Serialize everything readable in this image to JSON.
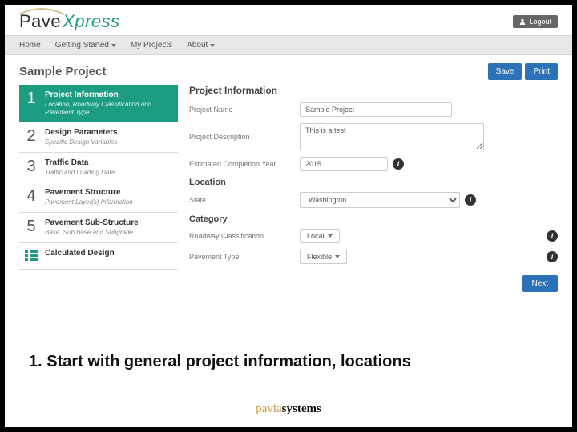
{
  "logo": {
    "part1": "Pave",
    "part2": "Xpress"
  },
  "logout_label": "Logout",
  "nav": {
    "home": "Home",
    "getting_started": "Getting Started",
    "my_projects": "My Projects",
    "about": "About"
  },
  "page_title": "Sample Project",
  "buttons": {
    "save": "Save",
    "print": "Print",
    "next": "Next"
  },
  "steps": [
    {
      "num": "1",
      "title": "Project Information",
      "sub": "Location, Roadway Classification and Pavement Type"
    },
    {
      "num": "2",
      "title": "Design Parameters",
      "sub": "Specific Design Variables"
    },
    {
      "num": "3",
      "title": "Traffic Data",
      "sub": "Traffic and Loading Data"
    },
    {
      "num": "4",
      "title": "Pavement Structure",
      "sub": "Pavement Layer(s) Information"
    },
    {
      "num": "5",
      "title": "Pavement Sub-Structure",
      "sub": "Base, Sub Base and Subgrade"
    }
  ],
  "calc_step": {
    "title": "Calculated Design"
  },
  "form": {
    "heading": "Project Information",
    "project_name_label": "Project Name",
    "project_name_value": "Sample Project",
    "project_desc_label": "Project Description",
    "project_desc_value": "This is a test",
    "year_label": "Estimated Completion Year",
    "year_value": "2015",
    "location_heading": "Location",
    "state_label": "State",
    "state_value": "Washington",
    "category_heading": "Category",
    "roadway_label": "Roadway Classification",
    "roadway_value": "Local",
    "pavement_label": "Pavement Type",
    "pavement_value": "Flexible"
  },
  "caption": "1. Start with general project information, locations",
  "footer": {
    "part1": "pavia",
    "part2": "systems"
  }
}
